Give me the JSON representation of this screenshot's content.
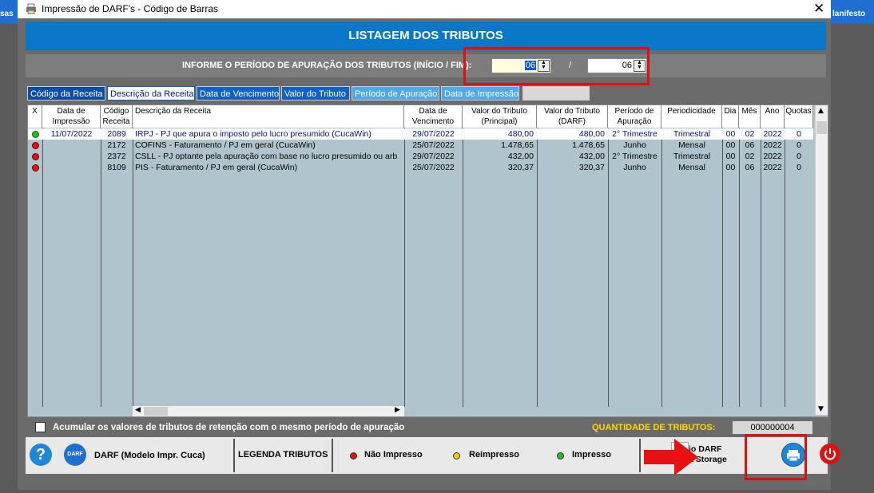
{
  "background": {
    "left_label": "sas",
    "right_label": "lanifesto"
  },
  "window": {
    "title": "Impressão de DARF's  -  Código de Barras",
    "close": "✕"
  },
  "banner": {
    "title": "LISTAGEM DOS TRIBUTOS"
  },
  "period": {
    "label": "INFORME O PERÍODO DE APURAÇÃO DOS TRIBUTOS (INÍCIO / FIM):",
    "start": "06",
    "end": "06",
    "separator": "/"
  },
  "tabs": [
    "Código da Receita",
    "Descrição da Receita",
    "Data de Vencimento",
    "Valor do Tributo",
    "Período de Apuração",
    "Data de Impressão"
  ],
  "columns": [
    [
      "X",
      ""
    ],
    [
      "Data de",
      "Impressão"
    ],
    [
      "Código",
      "Receita"
    ],
    [
      "Descrição da Receita",
      ""
    ],
    [
      "Data de",
      "Vencimento"
    ],
    [
      "Valor do Tributo",
      "(Principal)"
    ],
    [
      "Valor do Tributo",
      "(DARF)"
    ],
    [
      "Período de",
      "Apuração"
    ],
    [
      "Periodicidade",
      ""
    ],
    [
      "Dia",
      ""
    ],
    [
      "Mês",
      ""
    ],
    [
      "Ano",
      ""
    ],
    [
      "Quotas",
      ""
    ]
  ],
  "rows": [
    {
      "status": "impresso",
      "impressao": "11/07/2022",
      "codigo": "2089",
      "descricao": "IRPJ - PJ que apura o imposto pelo lucro presumido (CucaWin)",
      "vencimento": "29/07/2022",
      "principal": "480,00",
      "darf": "480,00",
      "periodo": "2° Trimestre",
      "periodicidade": "Trimestral",
      "dia": "00",
      "mes": "02",
      "ano": "2022",
      "quotas": "0"
    },
    {
      "status": "nao_impresso",
      "impressao": "",
      "codigo": "2172",
      "descricao": "COFINS - Faturamento / PJ em geral (CucaWin)",
      "vencimento": "25/07/2022",
      "principal": "1.478,65",
      "darf": "1.478,65",
      "periodo": "Junho",
      "periodicidade": "Mensal",
      "dia": "00",
      "mes": "06",
      "ano": "2022",
      "quotas": "0"
    },
    {
      "status": "nao_impresso",
      "impressao": "",
      "codigo": "2372",
      "descricao": "CSLL - PJ optante pela apuração com base no lucro presumido ou arb",
      "vencimento": "29/07/2022",
      "principal": "432,00",
      "darf": "432,00",
      "periodo": "2° Trimestre",
      "periodicidade": "Trimestral",
      "dia": "00",
      "mes": "02",
      "ano": "2022",
      "quotas": "0"
    },
    {
      "status": "nao_impresso",
      "impressao": "",
      "codigo": "8109",
      "descricao": "PIS - Faturamento / PJ em geral (CucaWin)",
      "vencimento": "25/07/2022",
      "principal": "320,37",
      "darf": "320,37",
      "periodo": "Junho",
      "periodicidade": "Mensal",
      "dia": "00",
      "mes": "06",
      "ano": "2022",
      "quotas": "0"
    }
  ],
  "accumulate": {
    "label": "Acumular os valores de tributos de retenção com o mesmo período de apuração"
  },
  "quantity": {
    "label": "QUANTIDADE DE TRIBUTOS:",
    "value": "000000004"
  },
  "footer": {
    "help": "?",
    "darf_icon": "DARF",
    "darf_label": "DARF (Modelo Impr. Cuca)",
    "legend_title": "LEGENDA TRIBUTOS",
    "legend": [
      {
        "label": "Não Impresso",
        "color": "#e01010"
      },
      {
        "label": "Reimpresso",
        "color": "#f0d000"
      },
      {
        "label": "Impresso",
        "color": "#20c020"
      }
    ],
    "storage_line1": "io DARF",
    "storage_line2": "a Storage"
  },
  "colors": {
    "accent": "#0b77c9",
    "highlight": "#e01010"
  }
}
